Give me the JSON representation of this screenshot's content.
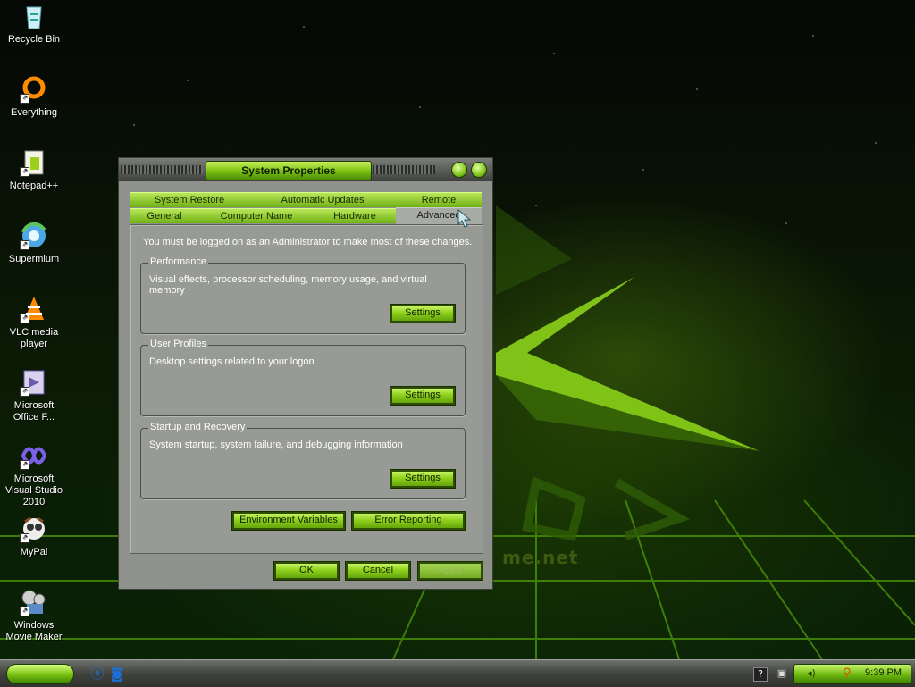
{
  "desktop": {
    "watermark": "me.net",
    "icons": [
      {
        "label": "Recycle Bin",
        "icon": "recycle-bin-icon"
      },
      {
        "label": "Everything",
        "icon": "everything-icon"
      },
      {
        "label": "Notepad++",
        "icon": "notepad-plus-plus-icon"
      },
      {
        "label": "Supermium",
        "icon": "supermium-icon"
      },
      {
        "label": "VLC media player",
        "icon": "vlc-icon"
      },
      {
        "label": "Microsoft Office F...",
        "icon": "office-icon"
      },
      {
        "label": "Microsoft Visual Studio 2010",
        "icon": "visual-studio-icon"
      },
      {
        "label": "MyPal",
        "icon": "mypal-icon"
      },
      {
        "label": "Windows Movie Maker",
        "icon": "movie-maker-icon"
      }
    ]
  },
  "window": {
    "title": "System Properties",
    "tabs_back": [
      "System Restore",
      "Automatic Updates",
      "Remote"
    ],
    "tabs_front": [
      "General",
      "Computer Name",
      "Hardware",
      "Advanced"
    ],
    "active_tab": "Advanced",
    "info_text": "You must be logged on as an Administrator to make most of these changes.",
    "groups": [
      {
        "label": "Performance",
        "desc": "Visual effects, processor scheduling, memory usage, and virtual memory",
        "button": "Settings"
      },
      {
        "label": "User Profiles",
        "desc": "Desktop settings related to your logon",
        "button": "Settings"
      },
      {
        "label": "Startup and Recovery",
        "desc": "System startup, system failure, and debugging information",
        "button": "Settings"
      }
    ],
    "env_button": "Environment Variables",
    "error_button": "Error Reporting",
    "ok": "OK",
    "cancel": "Cancel",
    "apply": "Apply"
  },
  "taskbar": {
    "clock": "9:39 PM",
    "quick_launch": [
      "internet-explorer-icon",
      "browser-icon"
    ],
    "tray_icons": [
      "help-icon",
      "network-icon",
      "volume-icon",
      "search-icon"
    ]
  },
  "colors": {
    "accent": "#8fd11c",
    "window_bg": "#979a95"
  }
}
